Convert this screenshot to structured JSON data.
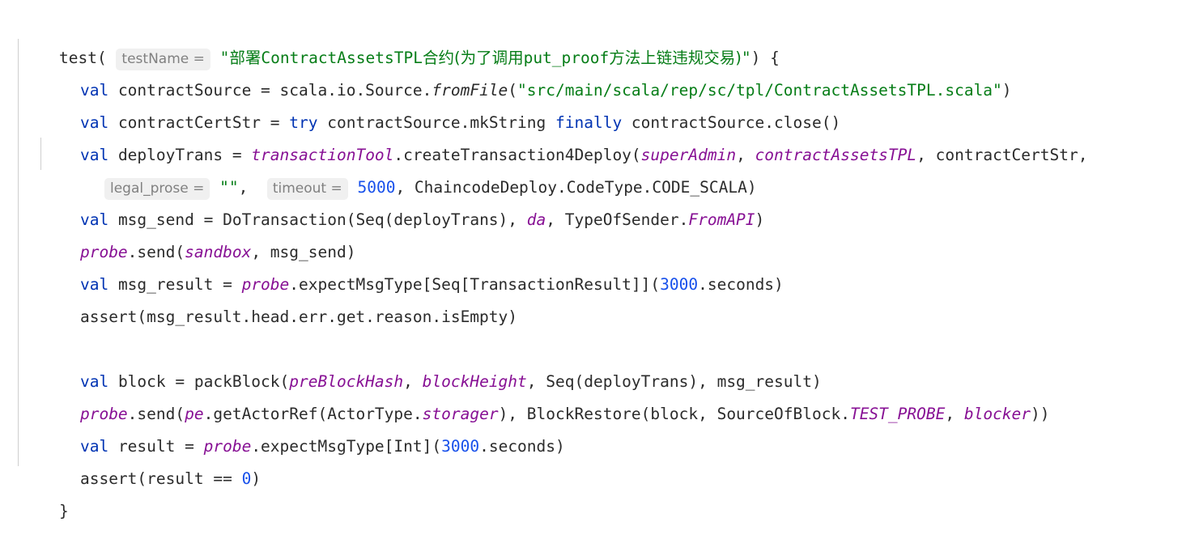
{
  "editor": {
    "language": "scala",
    "background": "#ffffff",
    "colors": {
      "default_text": "#2b2b2b",
      "keyword": "#0033b3",
      "string": "#067d17",
      "number": "#1750eb",
      "field_italic": "#871094",
      "param_hint_text": "#808080",
      "param_hint_background": "#f0f0f0",
      "indent_guide": "#cfcfcf"
    }
  },
  "code": {
    "line1": {
      "fn_name": "test",
      "paren_open": "( ",
      "hint_test_name": "testName =",
      "quote_open": " \"",
      "string_cjk_1": "部署",
      "string_id_1": "ContractAssetsTPL",
      "string_cjk_2": "合约(为了调用",
      "string_id_2": "put_proof",
      "string_cjk_3": "方法上链违规交易)",
      "quote_close": "\"",
      "tail": ") {"
    },
    "line2": {
      "kw_val": "val",
      "name": " contractSource = scala.io.Source.",
      "fn_from_file": "fromFile",
      "paren": "(",
      "path_string": "\"src/main/scala/rep/sc/tpl/ContractAssetsTPL.scala\"",
      "tail": ")"
    },
    "line3": {
      "kw_val": "val",
      "name": " contractCertStr = ",
      "kw_try": "try",
      "mid": " contractSource.mkString ",
      "kw_finally": "finally",
      "tail": " contractSource.close()"
    },
    "line4": {
      "kw_val": "val",
      "name": " deployTrans = ",
      "field_transaction_tool": "transactionTool",
      "call": ".createTransaction4Deploy(",
      "arg_super_admin": "superAdmin",
      "sep1": ", ",
      "arg_contract_assets_tpl": "contractAssetsTPL",
      "sep2": ", contractCertStr,"
    },
    "line5": {
      "hint_legal_prose": "legal_prose =",
      "empty_string": " \"\"",
      "comma1": ",  ",
      "hint_timeout": "timeout =",
      "num_timeout": " 5000",
      "tail": ", ChaincodeDeploy.CodeType.CODE_SCALA)"
    },
    "line6": {
      "kw_val": "val",
      "name": " msg_send = DoTransaction(Seq(deployTrans), ",
      "field_da": "da",
      "mid": ", TypeOfSender.",
      "field_from_api": "FromAPI",
      "tail": ")"
    },
    "line7": {
      "field_probe": "probe",
      "call": ".send(",
      "field_sandbox": "sandbox",
      "tail": ", msg_send)"
    },
    "line8": {
      "kw_val": "val",
      "name": " msg_result = ",
      "field_probe": "probe",
      "call": ".expectMsgType[Seq[TransactionResult]](",
      "num": "3000",
      "tail": ".seconds)"
    },
    "line9": {
      "text": "assert(msg_result.head.err.get.reason.isEmpty)"
    },
    "line10": {
      "text": ""
    },
    "line11": {
      "kw_val": "val",
      "name": " block = packBlock(",
      "field_pre_block_hash": "preBlockHash",
      "sep1": ", ",
      "field_block_height": "blockHeight",
      "tail": ", Seq(deployTrans), msg_result)"
    },
    "line12": {
      "field_probe": "probe",
      "call": ".send(",
      "field_pe": "pe",
      "mid1": ".getActorRef(ActorType.",
      "field_storager": "storager",
      "mid2": "), BlockRestore(block, SourceOfBlock.",
      "field_test_probe": "TEST_PROBE",
      "sep": ", ",
      "field_blocker": "blocker",
      "tail": "))"
    },
    "line13": {
      "kw_val": "val",
      "name": " result = ",
      "field_probe": "probe",
      "call": ".expectMsgType[Int](",
      "num": "3000",
      "tail": ".seconds)"
    },
    "line14": {
      "prefix": "assert(result == ",
      "num_zero": "0",
      "tail": ")"
    },
    "line15": {
      "text": "}"
    }
  }
}
